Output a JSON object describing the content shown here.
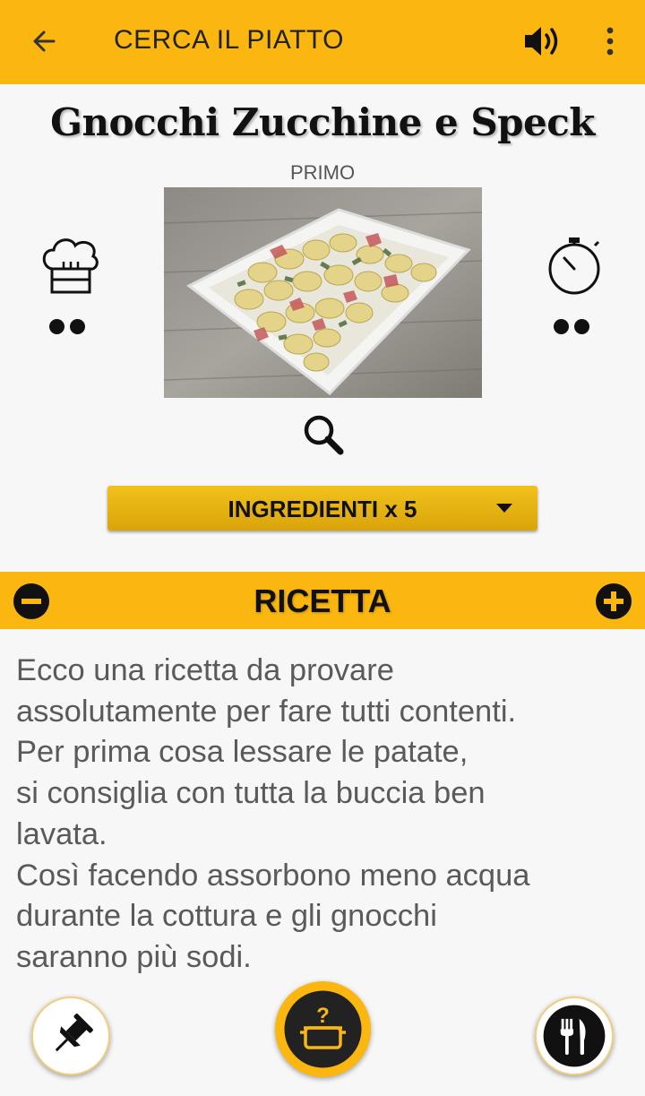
{
  "appbar": {
    "title": "CERCA IL PIATTO",
    "back_icon": "arrow-left-icon",
    "sound_icon": "volume-icon",
    "menu_icon": "more-vertical-icon"
  },
  "recipe": {
    "title": "Gnocchi Zucchine e Speck",
    "category": "PRIMO",
    "difficulty_level": 2,
    "time_level": 2
  },
  "ingredients_button": {
    "label": "INGREDIENTI x 5"
  },
  "section": {
    "heading": "RICETTA"
  },
  "recipe_text": "Ecco una ricetta da provare\nassolutamente per fare tutti contenti.\nPer prima cosa lessare le patate,\nsi consiglia con tutta la buccia ben\nlavata.\nCosì facendo assorbono meno acqua\ndurante la cottura e gli gnocchi\nsaranno più sodi.",
  "colors": {
    "accent": "#fbb710",
    "button_gold": "#e0ac12",
    "text": "#5a5a5a"
  }
}
